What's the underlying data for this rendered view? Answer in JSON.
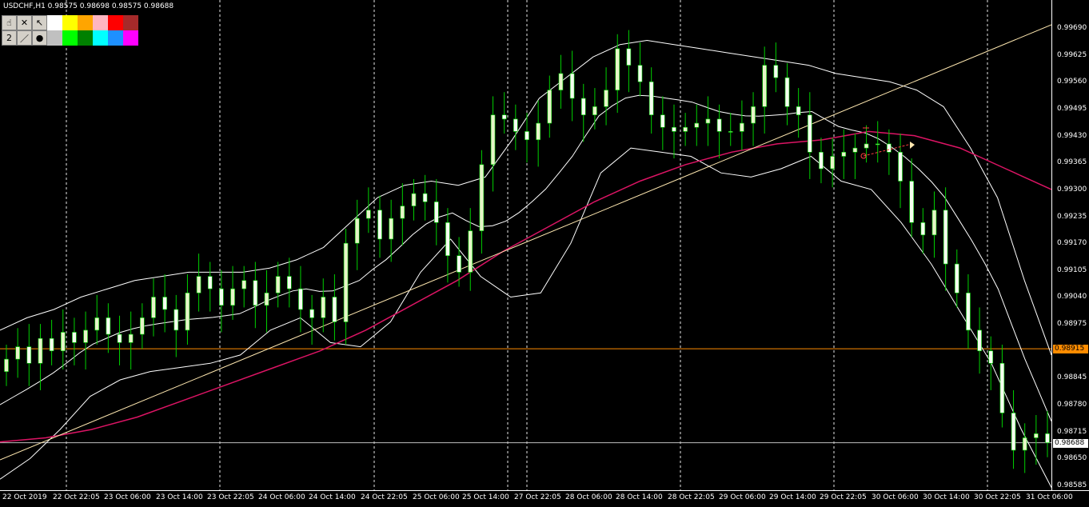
{
  "header": {
    "symbol_title": "USDCHF,H1  0.98575 0.98698 0.98575 0.98688"
  },
  "toolbar": {
    "row1_tools": [
      {
        "name": "hand-cursor-icon",
        "glyph": "☝"
      },
      {
        "name": "close-x-icon",
        "glyph": "✕"
      },
      {
        "name": "pointer-arrow-icon",
        "glyph": "↖"
      }
    ],
    "row1_colors": [
      "#ffffff",
      "#ffff00",
      "#ffa500",
      "#ffb6c1",
      "#ff0000",
      "#a52a2a"
    ],
    "row2_tools": [
      {
        "name": "line-width-input",
        "glyph": "2"
      },
      {
        "name": "line-style-icon",
        "glyph": "／"
      },
      {
        "name": "dot-icon",
        "glyph": "●"
      }
    ],
    "row2_colors": [
      "#c0c0c0",
      "#00ff00",
      "#008000",
      "#00ffff",
      "#1e90ff",
      "#ff00ff"
    ]
  },
  "price_axis": {
    "labels": [
      "0.99690",
      "0.99625",
      "0.99560",
      "0.99495",
      "0.99430",
      "0.99365",
      "0.99300",
      "0.99235",
      "0.99170",
      "0.99105",
      "0.99040",
      "0.98975",
      "0.98910",
      "0.98845",
      "0.98780",
      "0.98715",
      "0.98650",
      "0.98585"
    ],
    "horizontal_line_1": {
      "price": "0.98915",
      "color": "#ff8c00"
    },
    "horizontal_line_2": {
      "price": "0.98688",
      "color": "#ffffff"
    }
  },
  "time_axis": {
    "labels": [
      "22 Oct 2019",
      "22 Oct 22:05",
      "23 Oct 06:00",
      "23 Oct 14:00",
      "23 Oct 22:05",
      "24 Oct 06:00",
      "24 Oct 14:00",
      "24 Oct 22:05",
      "25 Oct 06:00",
      "25 Oct 14:00",
      "27 Oct 22:05",
      "28 Oct 06:00",
      "28 Oct 14:00",
      "28 Oct 22:05",
      "29 Oct 06:00",
      "29 Oct 14:00",
      "29 Oct 22:05",
      "30 Oct 06:00",
      "30 Oct 14:00",
      "30 Oct 22:05",
      "31 Oct 06:00"
    ]
  },
  "colors": {
    "background": "#000000",
    "bull_candle": "#e6f5c8",
    "bear_candle": "#f5fff0",
    "wick": "#00d000",
    "bands": "#ffffff",
    "ma_line": "#dc1464",
    "trend_line": "#ffe8b0",
    "period_separator": "#ffffff"
  },
  "chart_data": {
    "type": "candlestick",
    "title": "USDCHF,H1",
    "ylim": [
      0.9856,
      0.9972
    ],
    "close_series": [
      0.9889,
      0.9892,
      0.9888,
      0.9894,
      0.9891,
      0.98955,
      0.9893,
      0.9896,
      0.9899,
      0.9895,
      0.9893,
      0.9895,
      0.9899,
      0.9904,
      0.9901,
      0.9896,
      0.9905,
      0.9909,
      0.9906,
      0.9902,
      0.9906,
      0.9908,
      0.9902,
      0.9905,
      0.9909,
      0.9906,
      0.9901,
      0.9899,
      0.9904,
      0.9898,
      0.9917,
      0.9923,
      0.9925,
      0.9918,
      0.9923,
      0.9926,
      0.9929,
      0.9927,
      0.9922,
      0.9914,
      0.991,
      0.992,
      0.9936,
      0.9948,
      0.9947,
      0.9944,
      0.9942,
      0.9946,
      0.9954,
      0.9958,
      0.9952,
      0.9948,
      0.995,
      0.9954,
      0.9964,
      0.996,
      0.9956,
      0.9948,
      0.9945,
      0.9944,
      0.9945,
      0.9946,
      0.9947,
      0.9944,
      0.9944,
      0.9946,
      0.995,
      0.996,
      0.9957,
      0.995,
      0.9948,
      0.9939,
      0.9935,
      0.9938,
      0.9939,
      0.994,
      0.9941,
      0.9941,
      0.9939,
      0.9932,
      0.9922,
      0.9919,
      0.9925,
      0.9912,
      0.9905,
      0.9896,
      0.9891,
      0.9888,
      0.9876,
      0.9867,
      0.987,
      0.9871,
      0.98688
    ],
    "bands_upper": [
      0.9896,
      0.9899,
      0.9901,
      0.9904,
      0.9906,
      0.9908,
      0.9909,
      0.991,
      0.991,
      0.991,
      0.9911,
      0.9913,
      0.9916,
      0.9922,
      0.9928,
      0.9931,
      0.9932,
      0.9931,
      0.9933,
      0.9942,
      0.9952,
      0.9957,
      0.9962,
      0.9965,
      0.9966,
      0.9965,
      0.9964,
      0.9963,
      0.9962,
      0.9961,
      0.996,
      0.9958,
      0.9957,
      0.9956,
      0.9954,
      0.995,
      0.994,
      0.9928,
      0.9908,
      0.989
    ],
    "bands_lower": [
      0.986,
      0.9865,
      0.9872,
      0.988,
      0.9884,
      0.9886,
      0.9887,
      0.9888,
      0.989,
      0.9896,
      0.9899,
      0.9893,
      0.9892,
      0.9898,
      0.991,
      0.9918,
      0.9909,
      0.9904,
      0.9905,
      0.9917,
      0.9934,
      0.994,
      0.9939,
      0.9938,
      0.9934,
      0.9933,
      0.9935,
      0.9938,
      0.9932,
      0.993,
      0.9922,
      0.9912,
      0.99,
      0.9888,
      0.9872,
      0.9858
    ],
    "moving_average": [
      0.9869,
      0.987,
      0.9872,
      0.9875,
      0.9879,
      0.9883,
      0.9887,
      0.9891,
      0.9896,
      0.9902,
      0.9908,
      0.9915,
      0.9921,
      0.9927,
      0.9932,
      0.9936,
      0.9939,
      0.9941,
      0.9942,
      0.9944,
      0.9943,
      0.994,
      0.9935,
      0.993
    ]
  }
}
